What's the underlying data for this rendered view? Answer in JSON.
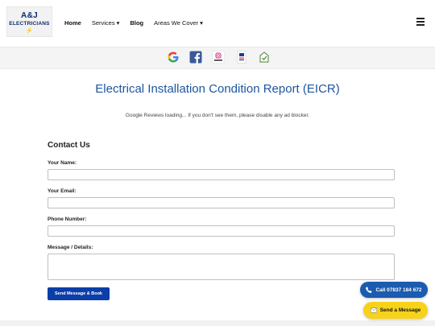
{
  "brand": {
    "line1": "A&J",
    "line2": "ELECTRICIANS",
    "primary_color": "#0b2a6e",
    "accent_color": "#e2b400"
  },
  "nav": {
    "items": [
      {
        "label": "Home"
      },
      {
        "label": "Services ▾"
      },
      {
        "label": "Blog"
      },
      {
        "label": "Areas We Cover ▾"
      }
    ],
    "menu_icon": "hamburger-menu-icon"
  },
  "social": {
    "icons": [
      "google-icon",
      "facebook-icon",
      "instagram-icon",
      "checkatrade-icon",
      "trustmark-icon"
    ]
  },
  "page": {
    "title": "Electrical Installation Condition Report (EICR)",
    "reviews_note": "Google Reviews loading... If you don't see them, please disable any ad blocker.",
    "title_color": "#1e56a0"
  },
  "form": {
    "heading": "Contact Us",
    "name_label": "Your Name:",
    "email_label": "Your Email:",
    "phone_label": "Phone Number:",
    "message_label": "Message / Details:",
    "name_value": "",
    "email_value": "",
    "phone_value": "",
    "message_value": "",
    "submit_label": "Send Message & Book",
    "submit_color": "#0b3ea8"
  },
  "floating": {
    "call_label": "Call 07837 184 672",
    "call_icon": "phone-icon",
    "call_color": "#1b5bb0",
    "message_label": "Send a Message",
    "message_icon": "envelope-icon",
    "message_color": "#f7d21a"
  }
}
